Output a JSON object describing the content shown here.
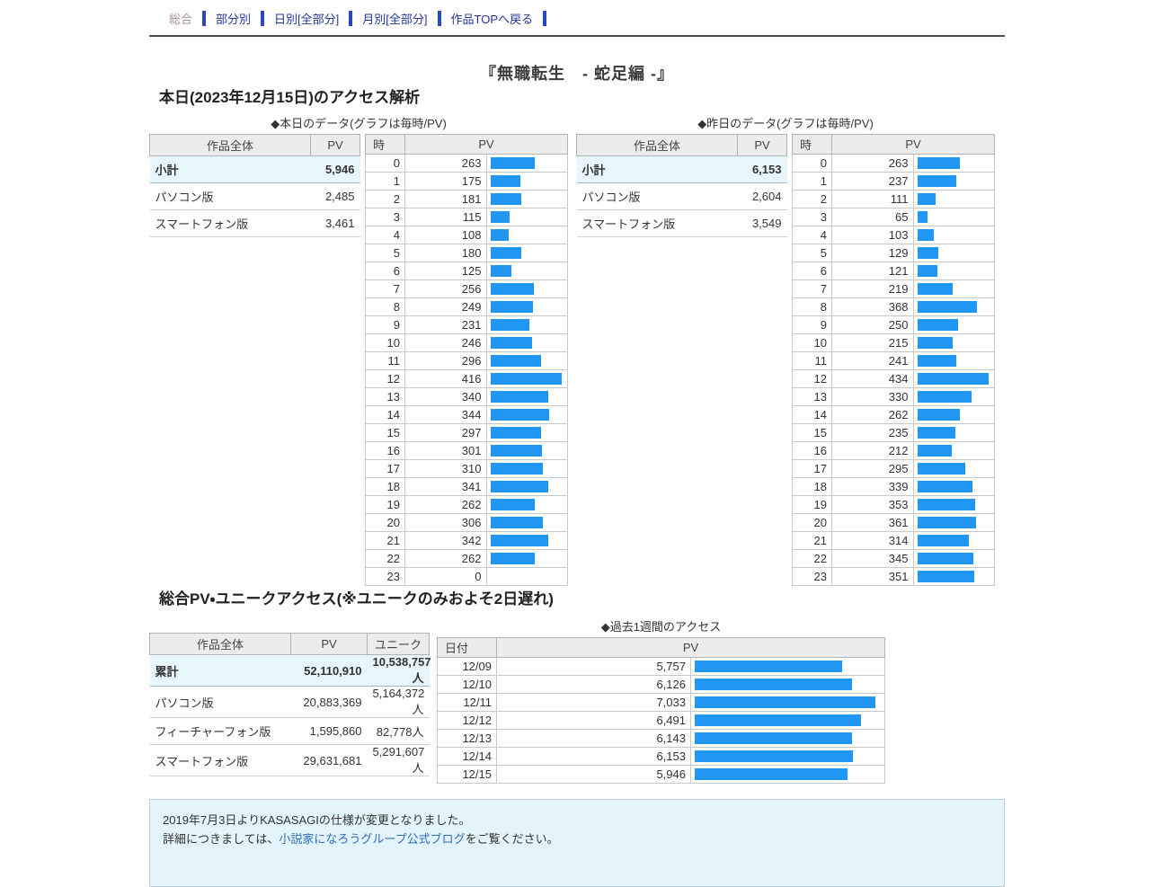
{
  "nav": {
    "items": [
      {
        "label": "総合",
        "current": true
      },
      {
        "label": "部分別",
        "current": false
      },
      {
        "label": "日別[全部分]",
        "current": false
      },
      {
        "label": "月別[全部分]",
        "current": false
      },
      {
        "label": "作品TOPへ戻る",
        "current": false
      }
    ]
  },
  "page_title": "『無職転生　- 蛇足編 -』",
  "colors": {
    "bar_blue": "#2196f3",
    "highlight_row": "#e7f6fa",
    "header_gray": "#ececec",
    "nav_separator": "#2a48c0"
  },
  "today": {
    "heading": "本日(2023年12月15日)のアクセス解析",
    "caption": "◆本日のデータ(グラフは毎時/PV)",
    "summary": {
      "headers": [
        "作品全体",
        "PV"
      ],
      "rows": [
        {
          "label": "小計",
          "pv": "5,946",
          "highlight": true
        },
        {
          "label": "パソコン版",
          "pv": "2,485"
        },
        {
          "label": "スマートフォン版",
          "pv": "3,461"
        }
      ]
    },
    "hourly": {
      "headers": [
        "時",
        "PV"
      ],
      "rows": [
        {
          "hour": "0",
          "pv": "263"
        },
        {
          "hour": "1",
          "pv": "175"
        },
        {
          "hour": "2",
          "pv": "181"
        },
        {
          "hour": "3",
          "pv": "115"
        },
        {
          "hour": "4",
          "pv": "108"
        },
        {
          "hour": "5",
          "pv": "180"
        },
        {
          "hour": "6",
          "pv": "125"
        },
        {
          "hour": "7",
          "pv": "256"
        },
        {
          "hour": "8",
          "pv": "249"
        },
        {
          "hour": "9",
          "pv": "231"
        },
        {
          "hour": "10",
          "pv": "246"
        },
        {
          "hour": "11",
          "pv": "296"
        },
        {
          "hour": "12",
          "pv": "416"
        },
        {
          "hour": "13",
          "pv": "340"
        },
        {
          "hour": "14",
          "pv": "344"
        },
        {
          "hour": "15",
          "pv": "297"
        },
        {
          "hour": "16",
          "pv": "301"
        },
        {
          "hour": "17",
          "pv": "310"
        },
        {
          "hour": "18",
          "pv": "341"
        },
        {
          "hour": "19",
          "pv": "262"
        },
        {
          "hour": "20",
          "pv": "306"
        },
        {
          "hour": "21",
          "pv": "342"
        },
        {
          "hour": "22",
          "pv": "262"
        },
        {
          "hour": "23",
          "pv": "0"
        }
      ]
    }
  },
  "yesterday": {
    "caption": "◆昨日のデータ(グラフは毎時/PV)",
    "summary": {
      "headers": [
        "作品全体",
        "PV"
      ],
      "rows": [
        {
          "label": "小計",
          "pv": "6,153",
          "highlight": true
        },
        {
          "label": "パソコン版",
          "pv": "2,604"
        },
        {
          "label": "スマートフォン版",
          "pv": "3,549"
        }
      ]
    },
    "hourly": {
      "headers": [
        "時",
        "PV"
      ],
      "rows": [
        {
          "hour": "0",
          "pv": "263"
        },
        {
          "hour": "1",
          "pv": "237"
        },
        {
          "hour": "2",
          "pv": "111"
        },
        {
          "hour": "3",
          "pv": "65"
        },
        {
          "hour": "4",
          "pv": "103"
        },
        {
          "hour": "5",
          "pv": "129"
        },
        {
          "hour": "6",
          "pv": "121"
        },
        {
          "hour": "7",
          "pv": "219"
        },
        {
          "hour": "8",
          "pv": "368"
        },
        {
          "hour": "9",
          "pv": "250"
        },
        {
          "hour": "10",
          "pv": "215"
        },
        {
          "hour": "11",
          "pv": "241"
        },
        {
          "hour": "12",
          "pv": "434"
        },
        {
          "hour": "13",
          "pv": "330"
        },
        {
          "hour": "14",
          "pv": "262"
        },
        {
          "hour": "15",
          "pv": "235"
        },
        {
          "hour": "16",
          "pv": "212"
        },
        {
          "hour": "17",
          "pv": "295"
        },
        {
          "hour": "18",
          "pv": "339"
        },
        {
          "hour": "19",
          "pv": "353"
        },
        {
          "hour": "20",
          "pv": "361"
        },
        {
          "hour": "21",
          "pv": "314"
        },
        {
          "hour": "22",
          "pv": "345"
        },
        {
          "hour": "23",
          "pv": "351"
        }
      ]
    }
  },
  "totals": {
    "heading": "総合PV・ユニークアクセス(※ユニークのみおよそ2日遅れ)",
    "summary": {
      "headers": [
        "作品全体",
        "PV",
        "ユニーク"
      ],
      "rows": [
        {
          "label": "累計",
          "pv": "52,110,910",
          "unique": "10,538,757人",
          "highlight": true
        },
        {
          "label": "パソコン版",
          "pv": "20,883,369",
          "unique": "5,164,372人"
        },
        {
          "label": "フィーチャーフォン版",
          "pv": "1,595,860",
          "unique": "82,778人"
        },
        {
          "label": "スマートフォン版",
          "pv": "29,631,681",
          "unique": "5,291,607人"
        }
      ]
    },
    "week": {
      "caption": "◆過去1週間のアクセス",
      "headers": [
        "日付",
        "PV"
      ],
      "rows": [
        {
          "date": "12/09",
          "pv": "5,757"
        },
        {
          "date": "12/10",
          "pv": "6,126"
        },
        {
          "date": "12/11",
          "pv": "7,033"
        },
        {
          "date": "12/12",
          "pv": "6,491"
        },
        {
          "date": "12/13",
          "pv": "6,143"
        },
        {
          "date": "12/14",
          "pv": "6,153"
        },
        {
          "date": "12/15",
          "pv": "5,946"
        }
      ]
    }
  },
  "notice": {
    "line1": "2019年7月3日よりKASASAGIの仕様が変更となりました。",
    "line2_before": "詳細につきましては、",
    "line2_link": "小説家になろうグループ公式ブログ",
    "line2_after": "をご覧ください。"
  }
}
